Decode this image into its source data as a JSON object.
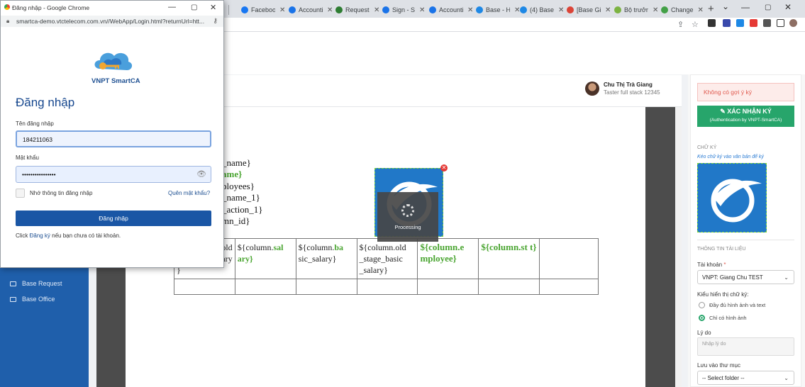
{
  "browser": {
    "tabs": [
      {
        "label": "Facebook",
        "color": "#1877f2"
      },
      {
        "label": "Accounti",
        "color": "#1a73e8"
      },
      {
        "label": "Requests",
        "color": "#2e7d32"
      },
      {
        "label": "Sign - S",
        "color": "#1a73e8"
      },
      {
        "label": "Accounti",
        "color": "#1a73e8"
      },
      {
        "label": "Base - H",
        "color": "#1e88e5"
      },
      {
        "label": "(4) Base",
        "color": "#1e88e5"
      },
      {
        "label": "[Base Gi",
        "color": "#db4437"
      },
      {
        "label": "Bộ trưởn",
        "color": "#7cb342"
      },
      {
        "label": "Change",
        "color": "#43a047"
      }
    ],
    "new_tab": "+",
    "minimize": "—",
    "close": "✕"
  },
  "popup": {
    "window_title": "Đăng nhập - Google Chrome",
    "url": "smartca-demo.vtctelecom.com.vn//WebApp/Login.html?returnUrl=htt...",
    "brand_name": "VNPT SmartCA",
    "heading": "Đăng nhập",
    "username_label": "Tên đăng nhập",
    "username_value": "184211063",
    "password_label": "Mật khẩu",
    "password_value": "••••••••••••••••",
    "remember_label": "Nhớ thông tin đăng nhập",
    "forgot_label": "Quên mật khẩu?",
    "login_button": "Đăng nhập",
    "register_prefix": "Click ",
    "register_link": "Đăng ký",
    "register_suffix": " nếu bạn chưa có tài khoản."
  },
  "sidebar": {
    "items": [
      {
        "label": "Base Request"
      },
      {
        "label": "Base Office"
      }
    ]
  },
  "user": {
    "name": "Chu Thị Trà Giang",
    "role": "Taster full stack 12345"
  },
  "document": {
    "template_lines": [
      {
        "text": "_name}",
        "green": false
      },
      {
        "text": "ame}",
        "green": true
      },
      {
        "text": "ployees}",
        "green": false
      },
      {
        "text": "_name_1}",
        "green": false
      },
      {
        "text": "_action_1}",
        "green": false
      },
      {
        "text": "mn_id}",
        "green": false
      }
    ],
    "table": {
      "cells": [
        {
          "a": "old",
          "b": "ary",
          "c": "}"
        },
        {
          "a": "${column.",
          "g": "sal",
          "b": "ary}"
        },
        {
          "a": "${column.",
          "g": "ba",
          "b": "sic_salary}"
        },
        {
          "a": "${column.old _stage_basic _salary}"
        },
        {
          "g": "${column.e mployee}"
        },
        {
          "g": "${column.st t}"
        },
        {}
      ]
    },
    "processing_label": "Processing"
  },
  "right_panel": {
    "warning": "Không có gợi ý ký",
    "confirm_title": "XÁC NHẬN KÝ",
    "confirm_sub": "(Authentication by VNPT-SmartCA)",
    "signature_label": "CHỮ KÝ",
    "signature_hint": "Kéo chữ ký vào văn bản để ký",
    "doc_info_label": "THÔNG TIN TÀI LIỆU",
    "account_label": "Tài khoản",
    "account_value": "VNPT: Giang Chu TEST",
    "display_label": "Kiểu hiển thị chữ ký:",
    "display_opt1": "Đầy đủ hình ảnh và text",
    "display_opt2": "Chỉ có hình ảnh",
    "display_selected": "Chỉ có hình ảnh",
    "reason_label": "Lý do",
    "reason_placeholder": "Nhập lý do",
    "folder_label": "Lưu vào thư mục",
    "folder_value": "-- Select folder --"
  },
  "colors": {
    "brand_blue": "#1a56a5",
    "confirm_green": "#27a56b",
    "template_green": "#4aa531",
    "sidebar_blue": "#1f5fab"
  }
}
